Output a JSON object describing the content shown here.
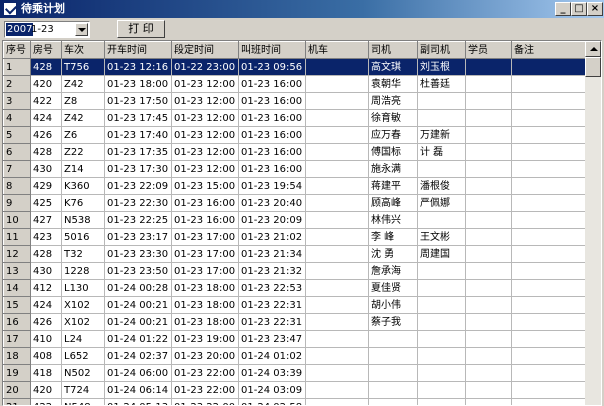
{
  "window": {
    "title": "待乘计划",
    "minimize": "_",
    "maximize": "□",
    "close": "×"
  },
  "toolbar": {
    "year_value": "2007",
    "date_value": "1-23",
    "print_label": "打 印"
  },
  "table": {
    "headers": [
      "序号",
      "房号",
      "车次",
      "开车时间",
      "段定时间",
      "叫班时间",
      "机车",
      "司机",
      "副司机",
      "学员",
      "备注"
    ],
    "rows": [
      [
        "1",
        "428",
        "T756",
        "01-23 12:16",
        "01-22 23:00",
        "01-23 09:56",
        "",
        "高文琪",
        "刘玉根",
        "",
        ""
      ],
      [
        "2",
        "420",
        "Z42",
        "01-23 18:00",
        "01-23 12:00",
        "01-23 16:00",
        "",
        "袁朝华",
        "杜善廷",
        "",
        ""
      ],
      [
        "3",
        "422",
        "Z8",
        "01-23 17:50",
        "01-23 12:00",
        "01-23 16:00",
        "",
        "周浩亮",
        "",
        "",
        ""
      ],
      [
        "4",
        "424",
        "Z42",
        "01-23 17:45",
        "01-23 12:00",
        "01-23 16:00",
        "",
        "徐育敏",
        "",
        "",
        ""
      ],
      [
        "5",
        "426",
        "Z6",
        "01-23 17:40",
        "01-23 12:00",
        "01-23 16:00",
        "",
        "应万春",
        "万建新",
        "",
        ""
      ],
      [
        "6",
        "428",
        "Z22",
        "01-23 17:35",
        "01-23 12:00",
        "01-23 16:00",
        "",
        "傅国标",
        "计 磊",
        "",
        ""
      ],
      [
        "7",
        "430",
        "Z14",
        "01-23 17:30",
        "01-23 12:00",
        "01-23 16:00",
        "",
        "施永满",
        "",
        "",
        ""
      ],
      [
        "8",
        "429",
        "K360",
        "01-23 22:09",
        "01-23 15:00",
        "01-23 19:54",
        "",
        "蒋建平",
        "潘根俊",
        "",
        ""
      ],
      [
        "9",
        "425",
        "K76",
        "01-23 22:30",
        "01-23 16:00",
        "01-23 20:40",
        "",
        "顾高峰",
        "严佩娜",
        "",
        ""
      ],
      [
        "10",
        "427",
        "N538",
        "01-23 22:25",
        "01-23 16:00",
        "01-23 20:09",
        "",
        "林伟兴",
        "",
        "",
        ""
      ],
      [
        "11",
        "423",
        "5016",
        "01-23 23:17",
        "01-23 17:00",
        "01-23 21:02",
        "",
        "李 峰",
        "王文彬",
        "",
        ""
      ],
      [
        "12",
        "428",
        "T32",
        "01-23 23:30",
        "01-23 17:00",
        "01-23 21:34",
        "",
        "沈 勇",
        "周建国",
        "",
        ""
      ],
      [
        "13",
        "430",
        "1228",
        "01-23 23:50",
        "01-23 17:00",
        "01-23 21:32",
        "",
        "詹承海",
        "",
        "",
        ""
      ],
      [
        "14",
        "412",
        "L130",
        "01-24 00:28",
        "01-23 18:00",
        "01-23 22:53",
        "",
        "夏佳贤",
        "",
        "",
        ""
      ],
      [
        "15",
        "424",
        "X102",
        "01-24 00:21",
        "01-23 18:00",
        "01-23 22:31",
        "",
        "胡小伟",
        "",
        "",
        ""
      ],
      [
        "16",
        "426",
        "X102",
        "01-24 00:21",
        "01-23 18:00",
        "01-23 22:31",
        "",
        "蔡子我",
        "",
        "",
        ""
      ],
      [
        "17",
        "410",
        "L24",
        "01-24 01:22",
        "01-23 19:00",
        "01-23 23:47",
        "",
        "",
        "",
        "",
        ""
      ],
      [
        "18",
        "408",
        "L652",
        "01-24 02:37",
        "01-23 20:00",
        "01-24 01:02",
        "",
        "",
        "",
        "",
        ""
      ],
      [
        "19",
        "418",
        "N502",
        "01-24 06:00",
        "01-23 22:00",
        "01-24 03:39",
        "",
        "",
        "",
        "",
        ""
      ],
      [
        "20",
        "420",
        "T724",
        "01-24 06:14",
        "01-23 22:00",
        "01-24 03:09",
        "",
        "",
        "",
        "",
        ""
      ],
      [
        "21",
        "422",
        "N548",
        "01-24 05:13",
        "01-23 22:00",
        "01-24 02:58",
        "",
        "",
        "",
        "",
        ""
      ]
    ]
  }
}
